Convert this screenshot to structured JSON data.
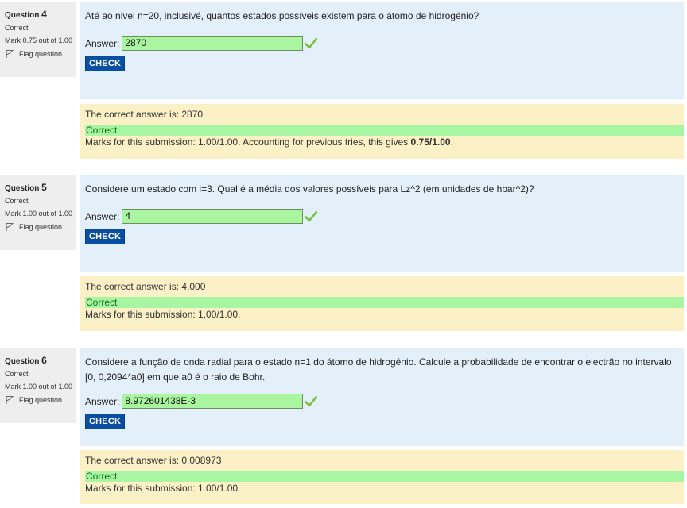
{
  "questions": [
    {
      "label": "Question",
      "number": "4",
      "state": "Correct",
      "grade": "Mark 0.75 out of 1.00",
      "flag": "Flag question",
      "text": "Até ao nivel n=20, inclusivé, quantos estados possíveis existem para o átomo de hidrogénio?",
      "answer_label": "Answer:",
      "answer_value": "2870",
      "check": "CHECK",
      "correct_answer": "The correct answer is: 2870",
      "feedback": "Correct",
      "marks_prefix": "Marks for this submission: 1.00/1.00. Accounting for previous tries, this gives ",
      "marks_bold": "0.75/1.00",
      "marks_suffix": "."
    },
    {
      "label": "Question",
      "number": "5",
      "state": "Correct",
      "grade": "Mark 1.00 out of 1.00",
      "flag": "Flag question",
      "text": "Considere um estado com l=3. Qual é a média dos valores possíveis para Lz^2 (em unidades de hbar^2)?",
      "answer_label": "Answer:",
      "answer_value": "4",
      "check": "CHECK",
      "correct_answer": "The correct answer is: 4,000",
      "feedback": "Correct",
      "marks_prefix": "Marks for this submission: 1.00/1.00."
    },
    {
      "label": "Question",
      "number": "6",
      "state": "Correct",
      "grade": "Mark 1.00 out of 1.00",
      "flag": "Flag question",
      "text": "Considere a função de onda radial para o estado n=1 do átomo de hidrogénio. Calcule a probabilidade de encontrar o electrão no intervalo [0, 0,2094*a0] em que a0 é o raio de Bohr.",
      "answer_label": "Answer:",
      "answer_value": "8.972601438E-3",
      "check": "CHECK",
      "correct_answer": "The correct answer is: 0,008973",
      "feedback": "Correct",
      "marks_prefix": "Marks for this submission: 1.00/1.00."
    }
  ],
  "colors": {
    "check_button": "#0a4ea1",
    "formulation_bg": "#e3eff9",
    "outcome_bg": "#fbf0c6",
    "correct_bg": "#a8f5a3",
    "tick": "#7cc242"
  },
  "icons": {
    "flag": "flag-icon",
    "tick": "check-mark-icon"
  }
}
